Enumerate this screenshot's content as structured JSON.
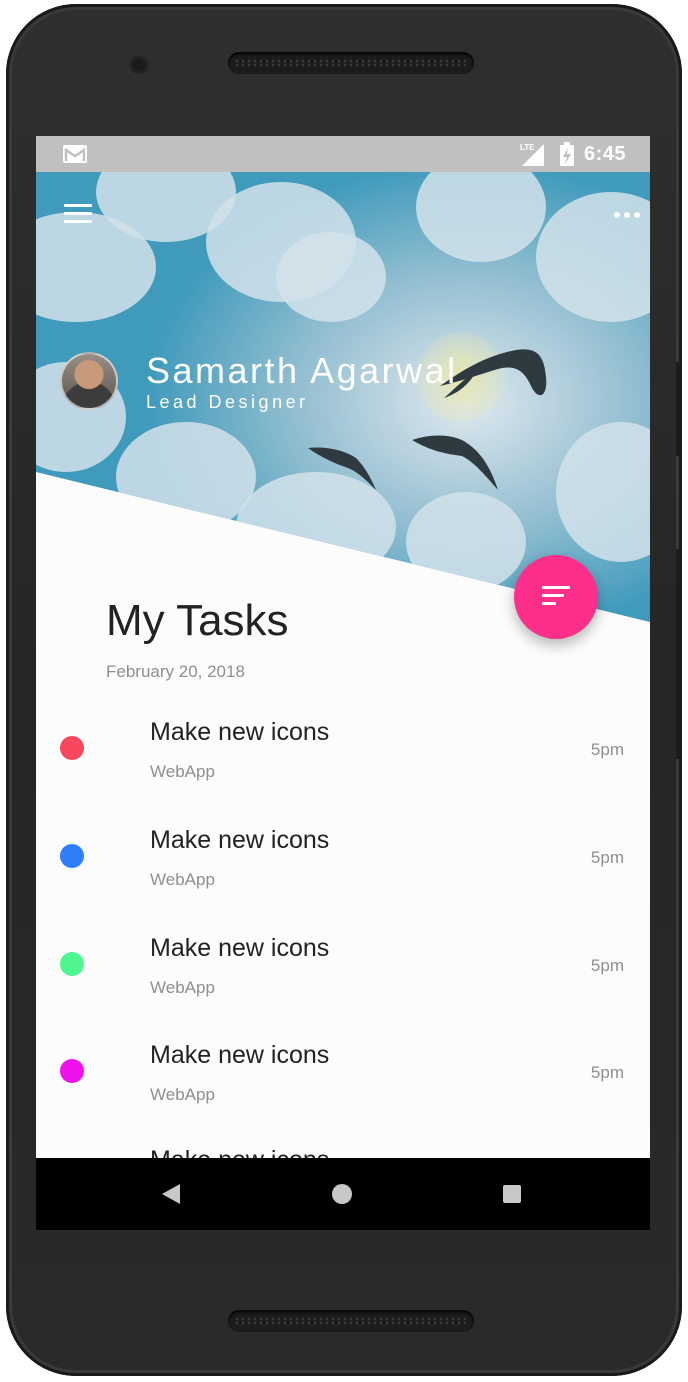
{
  "status_bar": {
    "time": "6:45",
    "icons": [
      "gmail-icon",
      "lte-signal-icon",
      "battery-charging-icon"
    ]
  },
  "header": {
    "menu_icon": "hamburger-menu-icon",
    "more_icon": "more-horizontal-icon",
    "user_name": "Samarth Agarwal",
    "user_role": "Lead Designer"
  },
  "fab": {
    "icon": "sort-filter-icon",
    "color": "#fc2f8a"
  },
  "tasks": {
    "title": "My Tasks",
    "date": "February 20, 2018",
    "items": [
      {
        "title": "Make new icons",
        "subtitle": "WebApp",
        "time": "5pm",
        "color": "#f9475d"
      },
      {
        "title": "Make new icons",
        "subtitle": "WebApp",
        "time": "5pm",
        "color": "#2e7ef8"
      },
      {
        "title": "Make new icons",
        "subtitle": "WebApp",
        "time": "5pm",
        "color": "#4ff58f"
      },
      {
        "title": "Make new icons",
        "subtitle": "WebApp",
        "time": "5pm",
        "color": "#f012ee"
      },
      {
        "title": "Make new icons"
      }
    ]
  },
  "nav_bar": {
    "icons": [
      "back-icon",
      "home-icon",
      "recents-icon"
    ]
  }
}
